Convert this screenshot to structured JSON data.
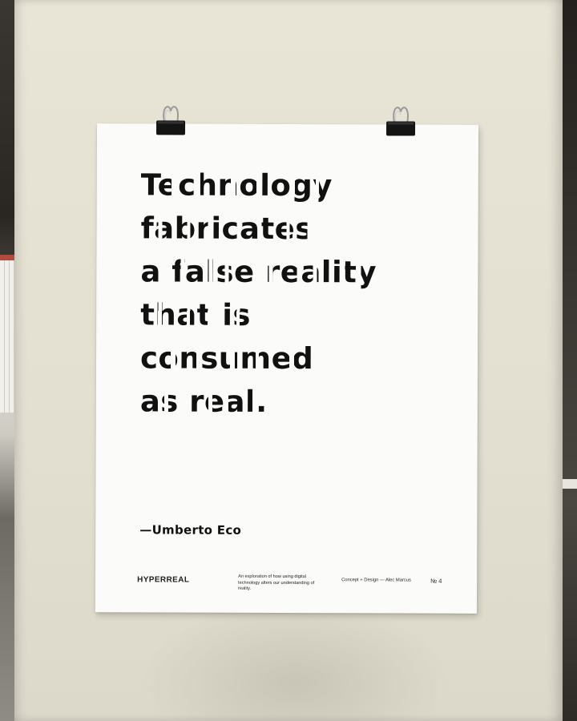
{
  "poster": {
    "quote_lines": [
      "Technology",
      "fabricates",
      "a false reality",
      "that is",
      "consumed",
      "as real."
    ],
    "attribution": "—Umberto Eco",
    "footer": {
      "brand": "HYPERREAL",
      "description": "An exploration of how using digital technology alters our understanding of reality.",
      "credit": "Concept + Design — Alec Marcus",
      "number": "№ 4"
    }
  },
  "colors": {
    "wall": "#e4e0d2",
    "paper": "#fbfbf9",
    "ink": "#111111"
  },
  "icons": {
    "clip": "binder-clip-icon"
  }
}
